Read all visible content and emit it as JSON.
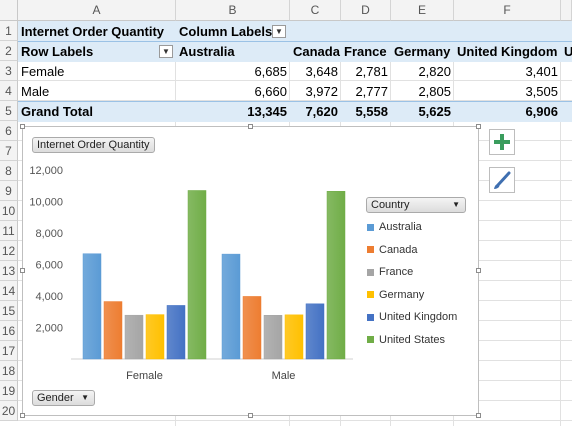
{
  "columns": [
    "A",
    "B",
    "C",
    "D",
    "E",
    "F"
  ],
  "rows": [
    "1",
    "2",
    "3",
    "4",
    "5",
    "6",
    "7",
    "8",
    "9",
    "10",
    "11",
    "12",
    "13",
    "14",
    "15",
    "16",
    "17",
    "18",
    "19",
    "20"
  ],
  "pivot": {
    "row1_a": "Internet Order Quantity",
    "row1_b": "Column Labels",
    "row2_a": "Row Labels",
    "headers": [
      "Australia",
      "Canada",
      "France",
      "Germany",
      "United Kingdom",
      "U"
    ],
    "female_label": "Female",
    "female_values": [
      "6,685",
      "3,648",
      "2,781",
      "2,820",
      "3,401"
    ],
    "male_label": "Male",
    "male_values": [
      "6,660",
      "3,972",
      "2,777",
      "2,805",
      "3,505"
    ],
    "total_label": "Grand Total",
    "total_values": [
      "13,345",
      "7,620",
      "5,558",
      "5,625",
      "6,906"
    ]
  },
  "chart": {
    "value_field_button": "Internet Order Quantity",
    "legend_field_button": "Country",
    "axis_field_button": "Gender"
  },
  "colors": {
    "Australia": "#5b9bd5",
    "Canada": "#ed7d31",
    "France": "#a5a5a5",
    "Germany": "#ffc000",
    "United Kingdom": "#4472c4",
    "United States": "#70ad47",
    "header_band": "#ddebf7"
  },
  "chart_data": {
    "type": "bar",
    "categories": [
      "Female",
      "Male"
    ],
    "series": [
      {
        "name": "Australia",
        "values": [
          6685,
          6660
        ]
      },
      {
        "name": "Canada",
        "values": [
          3648,
          3972
        ]
      },
      {
        "name": "France",
        "values": [
          2781,
          2777
        ]
      },
      {
        "name": "Germany",
        "values": [
          2820,
          2805
        ]
      },
      {
        "name": "United Kingdom",
        "values": [
          3401,
          3505
        ]
      },
      {
        "name": "United States",
        "values": [
          10700,
          10650
        ]
      }
    ],
    "yticks": [
      "2,000",
      "4,000",
      "6,000",
      "8,000",
      "10,000",
      "12,000"
    ],
    "ylim": [
      0,
      12000
    ],
    "legend_position": "right",
    "grid": false
  }
}
